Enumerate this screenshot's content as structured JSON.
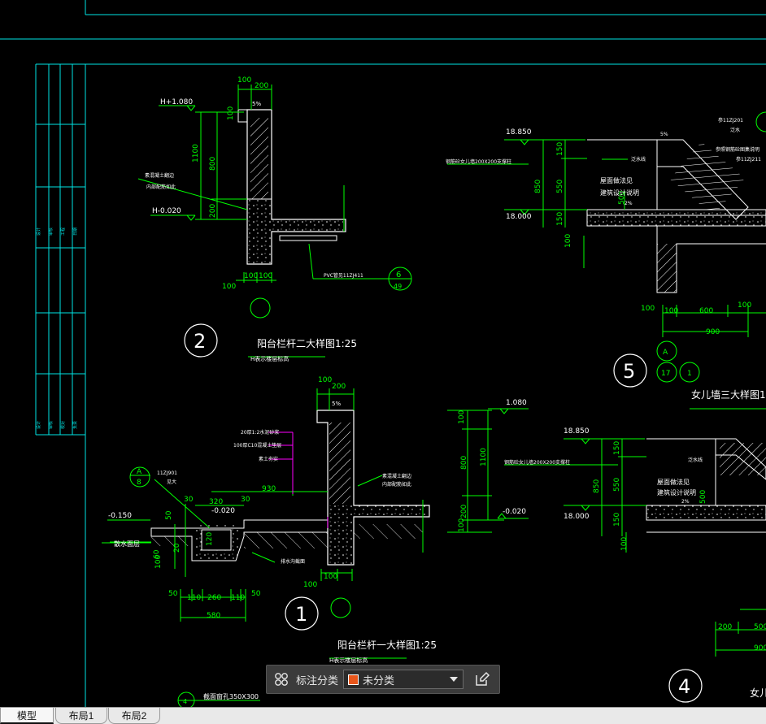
{
  "drawing": {
    "detail2": {
      "dim_top_100": "100",
      "dim_top_200": "200",
      "slope": "5%",
      "level_top": "H+1.080",
      "level_bottom": "H-0.020",
      "dim_1100": "1100",
      "dim_800": "800",
      "dim_200": "200",
      "dim_100": "100",
      "note_concrete": "素混凝土翻边",
      "note_concrete2": "内部配筋如此",
      "note_drain": "PVC管见11ZJ411",
      "ref_top": "6",
      "ref_bottom": "49",
      "circle_num": "2",
      "title": "阳台栏杆二大样图",
      "scale": "1:25",
      "subtitle": "H表示楼层标高",
      "dim_b100a": "100",
      "dim_b100b": "100",
      "dim_b100c": "100"
    },
    "detail1": {
      "dim_top_100": "100",
      "dim_top_200": "200",
      "slope": "5%",
      "note1": "20厚1:2水泥砂浆",
      "note2": "100厚C10混凝土垫层",
      "note3": "素土夯实",
      "note4": "素混凝土翻边",
      "note5": "内部配筋如此",
      "ref_a": "A",
      "ref_8": "8",
      "note_11zj": "11ZJ901",
      "note_gw": "见大",
      "dim_30a": "30",
      "dim_30b": "30",
      "dim_320": "320",
      "dim_930": "930",
      "level_m020": "-0.020",
      "level_m150": "-0.150",
      "dim_50": "50",
      "dim_120": "120",
      "dim_60": "60",
      "dim_20": "20",
      "dim_100": "100",
      "label_left": "散水面层",
      "note_gutter": "排水沟截面",
      "dim_b50a": "50",
      "dim_110a": "110",
      "dim_260": "260",
      "dim_110b": "110",
      "dim_b50b": "50",
      "dim_580": "580",
      "dim_b100a": "100",
      "dim_b100b": "100",
      "circle_num": "1",
      "title": "阳台栏杆一大样图",
      "scale": "1:25",
      "subtitle": "H表示楼层标高"
    },
    "mid_dims": {
      "level_top": "1.080",
      "dim_100": "100",
      "dim_800": "800",
      "dim_1100": "1100",
      "dim_200": "200",
      "dim_100b": "100",
      "level_bottom": "-0.020"
    },
    "detail5": {
      "level_top": "18.850",
      "level_bottom": "18.000",
      "dim_850": "850",
      "dim_150a": "150",
      "dim_550": "550",
      "dim_150b": "150",
      "dim_100": "100",
      "dim_500": "500",
      "note_beam": "钢筋砼女儿墙200X200支撑柱",
      "note_flash": "泛水线",
      "note_roof": "屋面做法见",
      "note_roof2": "建筑设计说明",
      "slope": "2%",
      "note_ref1": "参11ZJ201",
      "note_ref1b": "泛水",
      "note_ref2": "参11ZJ211",
      "note_ref2b": "参照钢筋砼图集说明",
      "slope_top": "5%",
      "dim_b100a": "100",
      "dim_b100b": "100",
      "dim_600": "600",
      "dim_b100c": "100",
      "dim_900": "900",
      "ref_a": "A",
      "ref_17": "17",
      "ref_1": "1",
      "circle_num": "5",
      "title": "女儿墙三大样图",
      "scale": "1:"
    },
    "detail4": {
      "level_top": "18.850",
      "level_bottom": "18.000",
      "dim_850": "850",
      "dim_150a": "150",
      "dim_550": "550",
      "dim_150b": "150",
      "dim_100": "100",
      "dim_500": "500",
      "note_beam": "钢筋砼女儿墙200X200支撑柱",
      "note_flash": "泛水线",
      "note_roof": "屋面做法见",
      "note_roof2": "建筑设计说明",
      "slope": "2%",
      "dim_200": "200",
      "dim_500b": "500",
      "dim_900": "900",
      "circle_num": "4",
      "title_part": "女儿"
    },
    "bottom_left": {
      "ref": "4",
      "note": "截面窗孔350X300"
    }
  },
  "toolbar": {
    "category_label": "标注分类",
    "selected_value": "未分类",
    "swatch_color": "#e8561b"
  },
  "tabs": [
    {
      "label": "模型"
    },
    {
      "label": "布局1"
    },
    {
      "label": "布局2"
    }
  ],
  "colors": {
    "background": "#000000",
    "frame": "#00e5e5",
    "geometry": "#ffffff",
    "dimension": "#00ff00",
    "annotation": "#ff00ff"
  }
}
